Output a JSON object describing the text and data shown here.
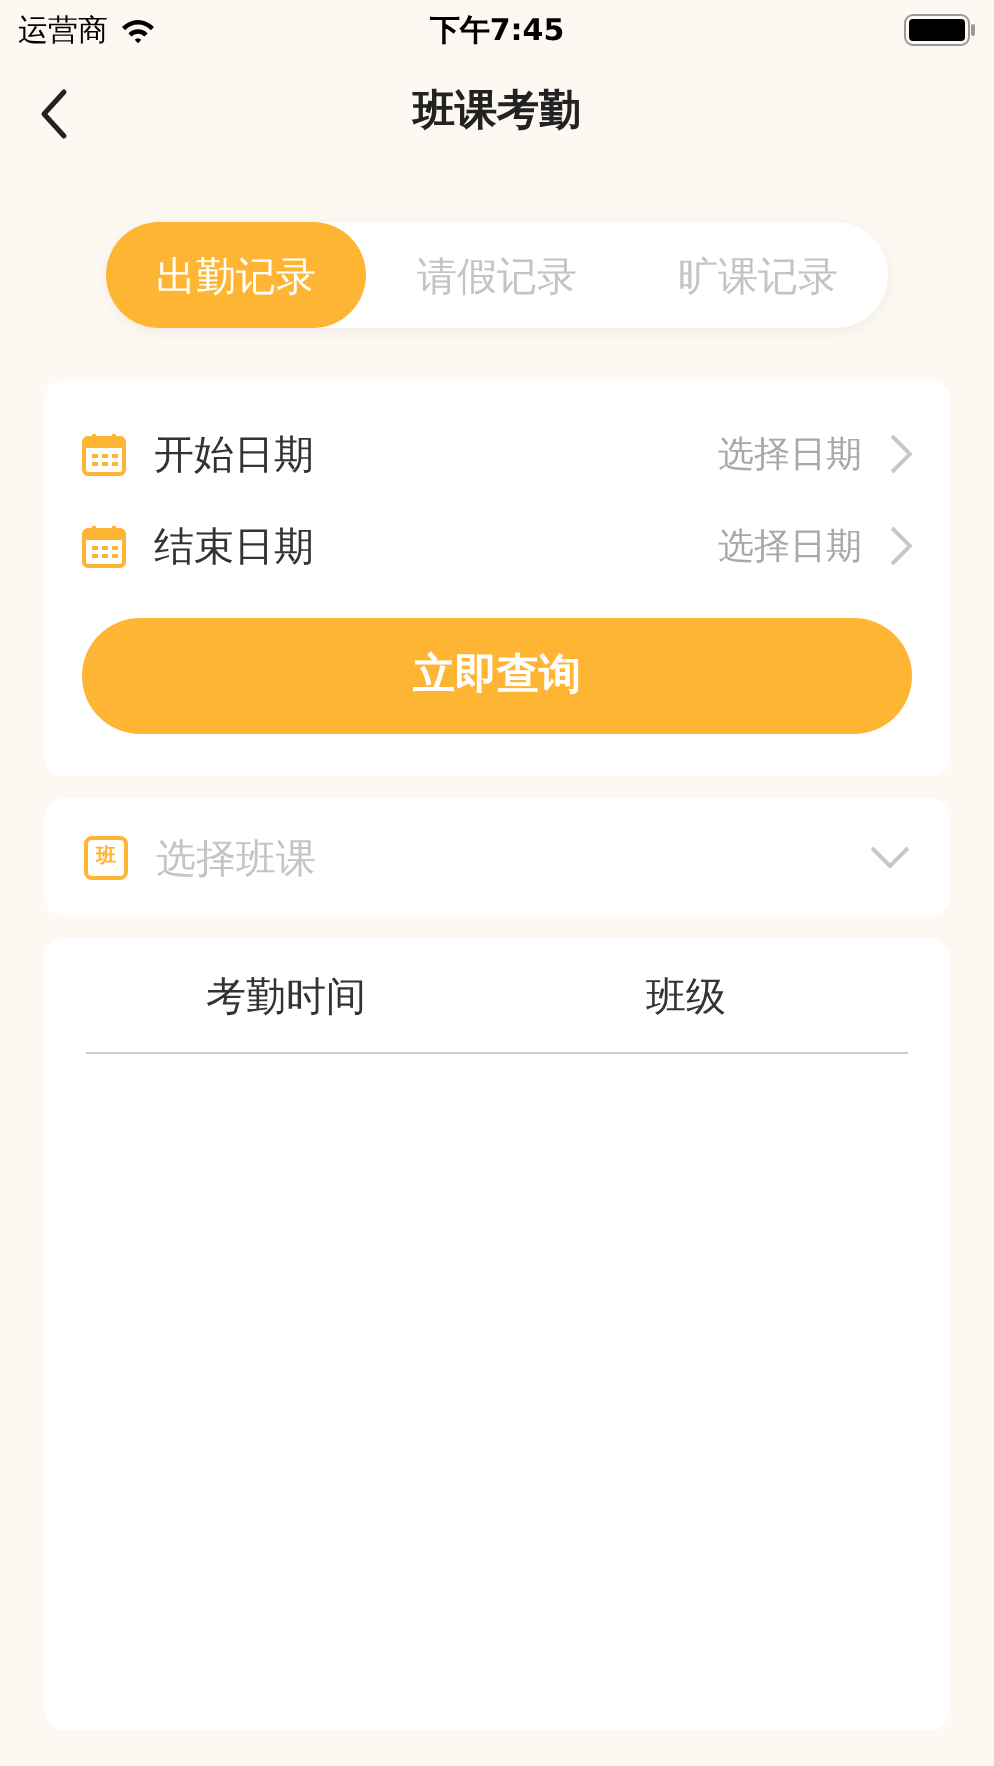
{
  "status_bar": {
    "carrier": "运营商",
    "time": "下午7:45"
  },
  "nav": {
    "title": "班课考勤"
  },
  "tabs": [
    {
      "label": "出勤记录",
      "selected": true
    },
    {
      "label": "请假记录",
      "selected": false
    },
    {
      "label": "旷课记录",
      "selected": false
    }
  ],
  "date_rows": [
    {
      "label": "开始日期",
      "placeholder": "选择日期"
    },
    {
      "label": "结束日期",
      "placeholder": "选择日期"
    }
  ],
  "query_button": "立即查询",
  "class_select": {
    "badge": "班",
    "placeholder": "选择班课"
  },
  "table": {
    "columns": [
      "考勤时间",
      "班级"
    ]
  }
}
